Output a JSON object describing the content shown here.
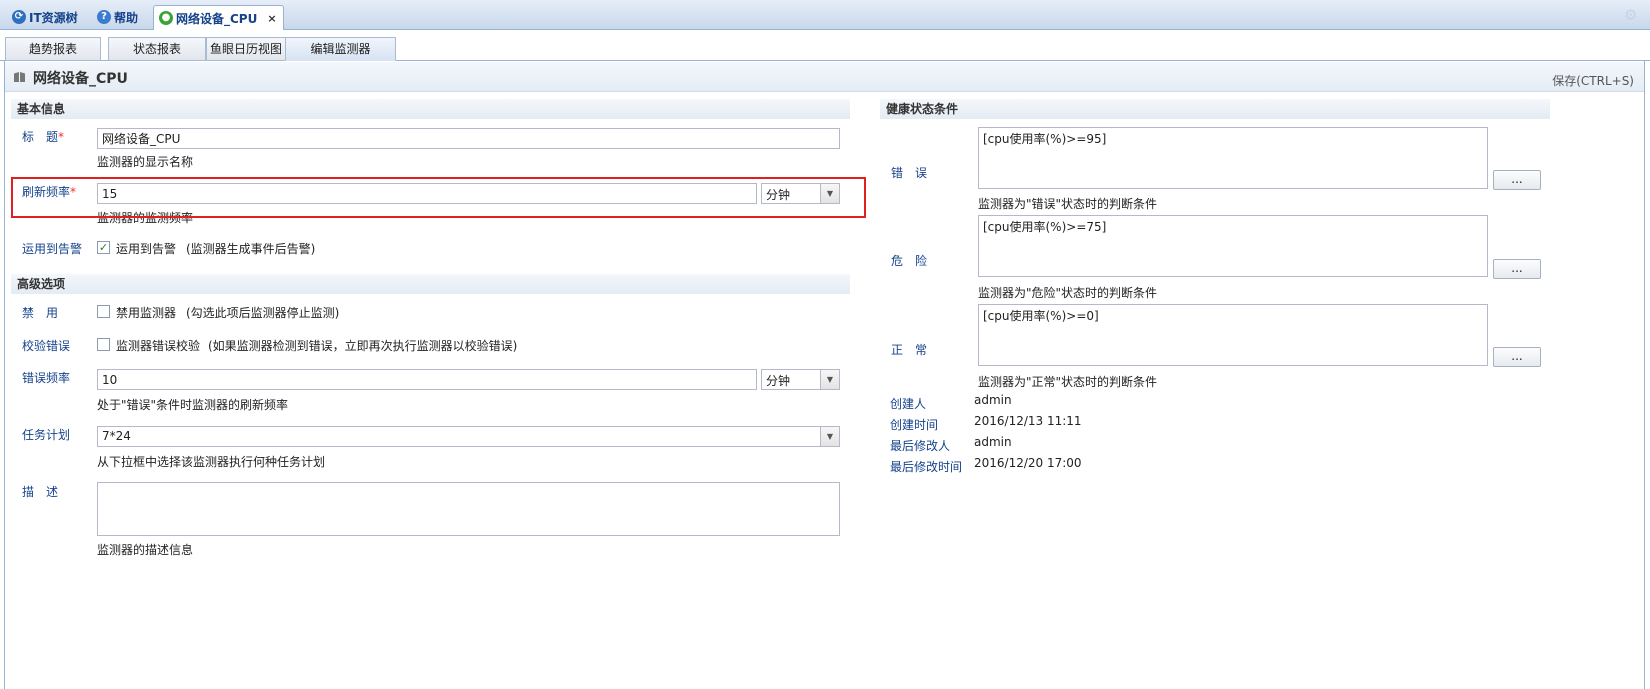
{
  "top_tabs": [
    {
      "label": "IT资源树",
      "icon": "resource-tree-icon"
    },
    {
      "label": "帮助",
      "icon": "help-icon"
    },
    {
      "label": "网络设备_CPU",
      "icon": "monitor-green-icon"
    }
  ],
  "sub_tabs": [
    "趋势报表",
    "状态报表",
    "鱼眼日历视图",
    "编辑监测器"
  ],
  "panel": {
    "title": "网络设备_CPU",
    "save_label": "保存(CTRL+S)"
  },
  "basic": {
    "header": "基本信息",
    "title_label": "标　题",
    "title_value": "网络设备_CPU",
    "title_hint": "监测器的显示名称",
    "freq_label": "刷新频率",
    "freq_value": "15",
    "freq_unit": "分钟",
    "freq_hint": "监测器的监测频率",
    "alarm_label": "运用到告警",
    "alarm_check_label": "运用到告警",
    "alarm_note": "(监测器生成事件后告警)"
  },
  "advanced": {
    "header": "高级选项",
    "disable_label": "禁　用",
    "disable_check_label": "禁用监测器",
    "disable_note": "(勾选此项后监测器停止监测)",
    "verify_label": "校验错误",
    "verify_check_label": "监测器错误校验",
    "verify_note": "(如果监测器检测到错误，立即再次执行监测器以校验错误)",
    "errfreq_label": "错误频率",
    "errfreq_value": "10",
    "errfreq_unit": "分钟",
    "errfreq_hint": "处于\"错误\"条件时监测器的刷新频率",
    "schedule_label": "任务计划",
    "schedule_value": "7*24",
    "schedule_hint": "从下拉框中选择该监测器执行何种任务计划",
    "desc_label": "描　述",
    "desc_value": "",
    "desc_hint": "监测器的描述信息"
  },
  "health": {
    "header": "健康状态条件",
    "error_label": "错　误",
    "error_value": "[cpu使用率(%)>=95]",
    "error_hint": "监测器为\"错误\"状态时的判断条件",
    "warn_label": "危　险",
    "warn_value": "[cpu使用率(%)>=75]",
    "warn_hint": "监测器为\"危险\"状态时的判断条件",
    "ok_label": "正　常",
    "ok_value": "[cpu使用率(%)>=0]",
    "ok_hint": "监测器为\"正常\"状态时的判断条件",
    "button_label": "..."
  },
  "meta": {
    "creator_label": "创建人",
    "creator_value": "admin",
    "created_label": "创建时间",
    "created_value": "2016/12/13 11:11",
    "modifier_label": "最后修改人",
    "modifier_value": "admin",
    "modified_label": "最后修改时间",
    "modified_value": "2016/12/20 17:00"
  },
  "colors": {
    "accent": "#15428b",
    "highlight": "#e02020",
    "required": "#e33333"
  }
}
